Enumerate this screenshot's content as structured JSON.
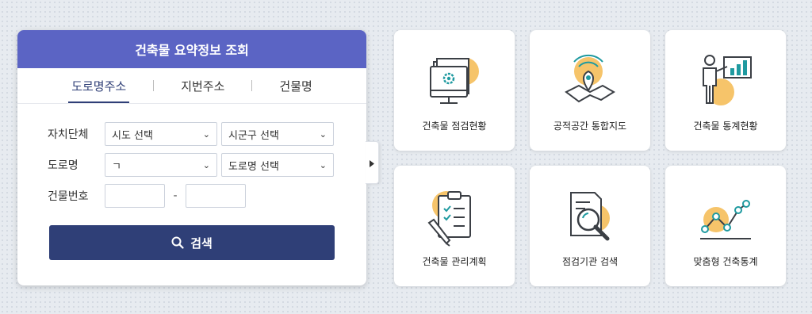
{
  "panel": {
    "title": "건축물 요약정보 조회",
    "tabs": [
      {
        "label": "도로명주소",
        "active": true
      },
      {
        "label": "지번주소",
        "active": false
      },
      {
        "label": "건물명",
        "active": false
      }
    ],
    "fields": {
      "region_label": "자치단체",
      "sido_value": "시도 선택",
      "sigungu_value": "시군구 선택",
      "road_label": "도로명",
      "initial_value": "ㄱ",
      "road_value": "도로명 선택",
      "building_no_label": "건물번호",
      "dash": "-"
    },
    "search_label": "검색"
  },
  "cards": [
    {
      "label": "건축물 점검현황",
      "icon": "monitor-gear-icon"
    },
    {
      "label": "공적공간 통합지도",
      "icon": "map-pin-icon"
    },
    {
      "label": "건축물 통계현황",
      "icon": "presentation-chart-icon"
    },
    {
      "label": "건축물 관리계획",
      "icon": "clipboard-checklist-icon"
    },
    {
      "label": "점검기관 검색",
      "icon": "document-magnifier-icon"
    },
    {
      "label": "맞춤형 건축통계",
      "icon": "line-trend-icon"
    }
  ],
  "colors": {
    "header": "#5b64c4",
    "button": "#2f3f77",
    "accent": "#f6b94a",
    "line": "#3b3f45"
  }
}
